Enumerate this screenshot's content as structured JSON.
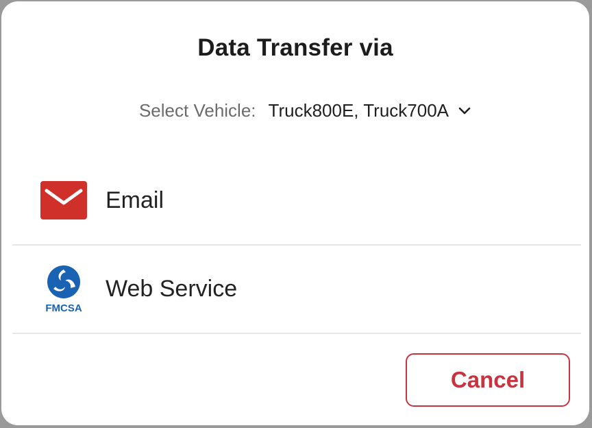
{
  "dialog": {
    "title": "Data Transfer via"
  },
  "vehicle": {
    "label": "Select Vehicle:",
    "selected": "Truck800E, Truck700A",
    "icon": "chevron-down-icon"
  },
  "options": [
    {
      "label": "Email",
      "icon": "envelope-icon",
      "icon_color": "#d0302a"
    },
    {
      "label": "Web Service",
      "icon": "fmcsa-logo-icon",
      "icon_text": "FMCSA",
      "icon_color": "#1a63b3"
    }
  ],
  "actions": {
    "cancel_label": "Cancel",
    "accent_color": "#c8333f"
  }
}
